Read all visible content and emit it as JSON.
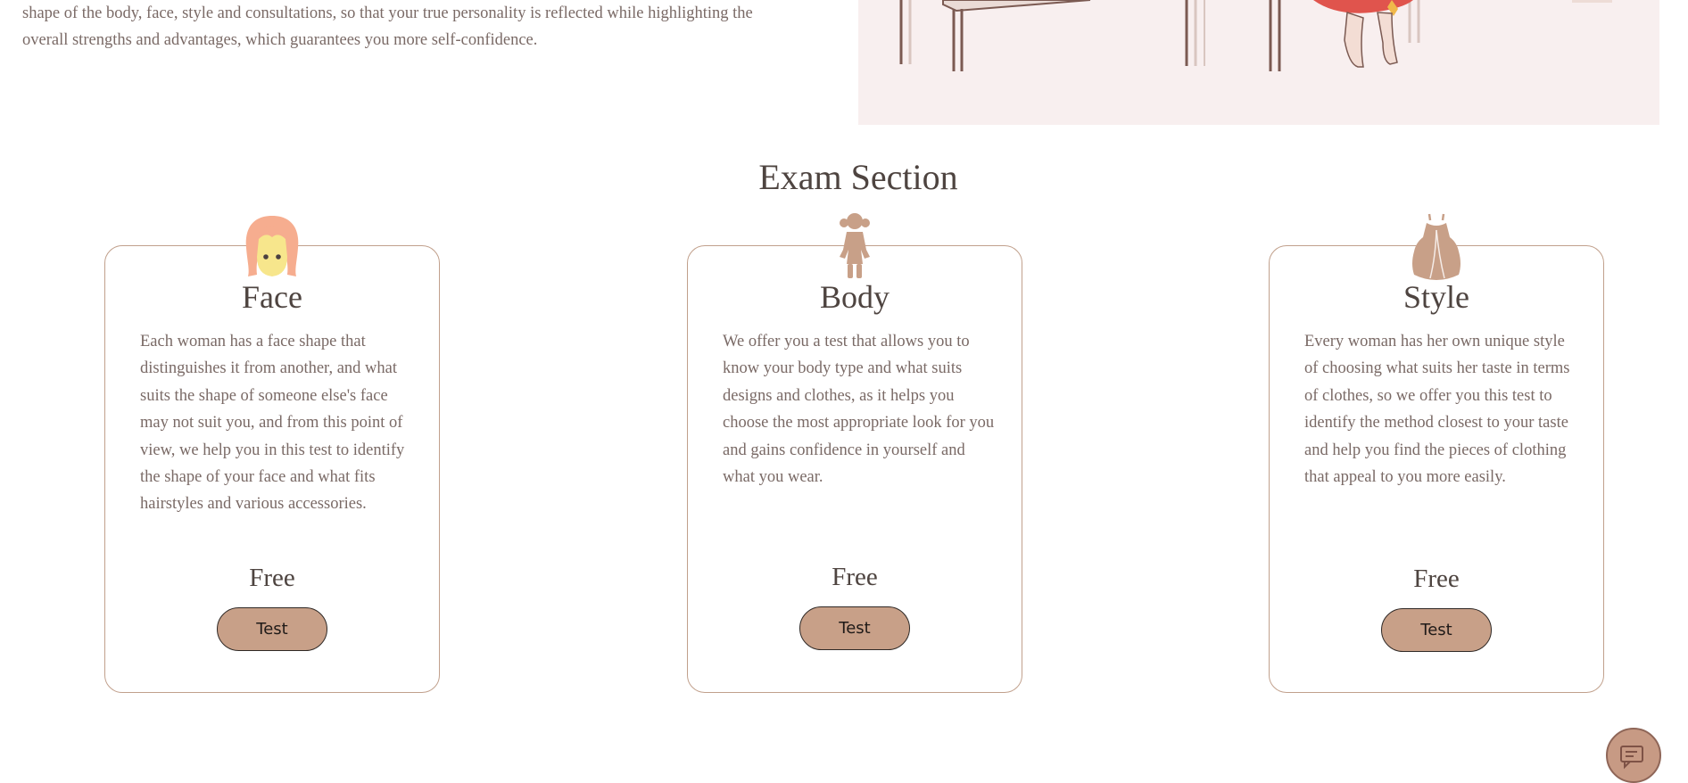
{
  "intro": {
    "line1": "shape of the body, face, style and consultations, so that your true personality is reflected while highlighting the",
    "line2": "overall strengths and advantages, which guarantees you more self-confidence."
  },
  "exam": {
    "title": "Exam Section",
    "cards": [
      {
        "title": "Face",
        "icon": "face-icon",
        "description": "Each woman has a face shape that distinguishes it from another, and what suits the shape of someone else's face may not suit you, and from this point of view, we help you in this test to identify the shape of your face and what fits hairstyles and various accessories.",
        "price": "Free",
        "button": "Test"
      },
      {
        "title": "Body",
        "icon": "girl-body-icon",
        "description": "We offer you a test that allows you to know your body type and what suits designs and clothes, as it helps you choose the most appropriate look for you and gains confidence in yourself and what you wear.",
        "price": "Free",
        "button": "Test"
      },
      {
        "title": "Style",
        "icon": "dress-icon",
        "description": "Every woman has her own unique style of choosing what suits her taste in terms of clothes, so we offer you this test to identify the method closest to your taste and help you find the pieces of clothing that appeal to you more easily.",
        "price": "Free",
        "button": "Test"
      }
    ]
  },
  "chat": {
    "icon": "chat-icon"
  },
  "colors": {
    "accent": "#c8a088",
    "border": "#c1a08c",
    "text": "#7a6a66",
    "heading": "#4e4440",
    "hero_bg": "#f8efef"
  }
}
